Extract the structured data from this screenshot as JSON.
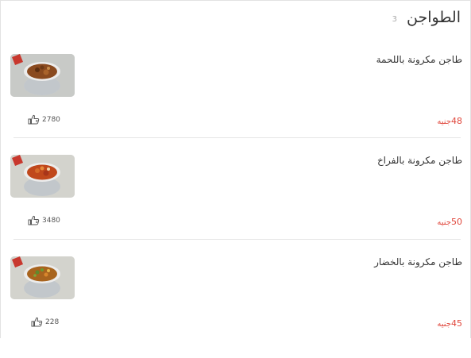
{
  "category": {
    "title": "الطواجن",
    "count": "3"
  },
  "currency_label": "جنيه",
  "items": [
    {
      "name": "طاجن مكرونة باللحمة",
      "price": "48",
      "likes": "2780",
      "image_icon": "tagine-meat-dish"
    },
    {
      "name": "طاجن مكرونة بالفراخ",
      "price": "50",
      "likes": "3480",
      "image_icon": "tagine-chicken-dish"
    },
    {
      "name": "طاجن مكرونة بالخضار",
      "price": "45",
      "likes": "228",
      "image_icon": "tagine-vegetable-dish"
    }
  ],
  "colors": {
    "price": "#e0463b",
    "divider": "#e6e6e6"
  }
}
